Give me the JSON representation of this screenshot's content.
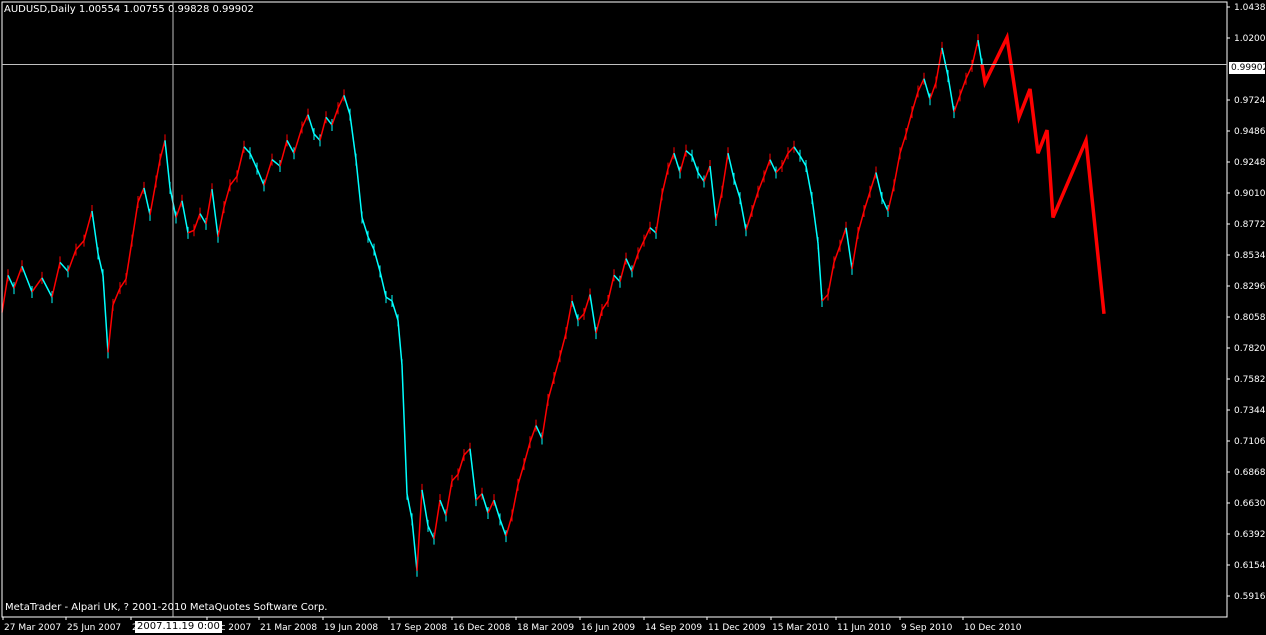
{
  "header": {
    "symbol_line": "AUDUSD,Daily  1.00554 1.00755 0.99828 0.99902"
  },
  "footer": {
    "copyright": "MetaTrader - Alpari UK, ? 2001-2010 MetaQuotes Software Corp."
  },
  "crosshair": {
    "date_label": "2007.11.19 0:00",
    "price_label": "0.99902"
  },
  "colors": {
    "background": "#000000",
    "bull": "#00ffff",
    "bear": "#ff0000",
    "projection": "#ff0000",
    "grid_text": "#ffffff"
  },
  "chart_data": {
    "type": "line",
    "symbol": "AUDUSD",
    "timeframe": "Daily",
    "ylim": [
      0.5916,
      1.0438
    ],
    "y_ticks": [
      "1.04380",
      "1.02000",
      "0.99902",
      "0.97240",
      "0.94860",
      "0.92480",
      "0.90100",
      "0.87720",
      "0.85340",
      "0.82960",
      "0.80580",
      "0.78200",
      "0.75820",
      "0.73440",
      "0.71060",
      "0.68680",
      "0.66300",
      "0.63920",
      "0.61540",
      "0.59160"
    ],
    "x_ticks": [
      "27 Mar 2007",
      "25 Jun 2007",
      "2",
      "Dec 2007",
      "21 Mar 2008",
      "19 Jun 2008",
      "17 Sep 2008",
      "16 Dec 2008",
      "18 Mar 2009",
      "16 Jun 2009",
      "14 Sep 2009",
      "11 Dec 2009",
      "15 Mar 2010",
      "11 Jun 2010",
      "9 Sep 2010",
      "10 Dec 2010"
    ],
    "crosshair_price": 0.99902,
    "price_path": [
      [
        0,
        0.806
      ],
      [
        6,
        0.835
      ],
      [
        12,
        0.825
      ],
      [
        20,
        0.842
      ],
      [
        30,
        0.822
      ],
      [
        40,
        0.833
      ],
      [
        50,
        0.818
      ],
      [
        58,
        0.845
      ],
      [
        66,
        0.838
      ],
      [
        74,
        0.855
      ],
      [
        82,
        0.862
      ],
      [
        90,
        0.885
      ],
      [
        96,
        0.852
      ],
      [
        101,
        0.835
      ],
      [
        106,
        0.775
      ],
      [
        111,
        0.812
      ],
      [
        118,
        0.825
      ],
      [
        124,
        0.832
      ],
      [
        130,
        0.862
      ],
      [
        136,
        0.892
      ],
      [
        142,
        0.903
      ],
      [
        148,
        0.882
      ],
      [
        154,
        0.908
      ],
      [
        158,
        0.925
      ],
      [
        163,
        0.94
      ],
      [
        168,
        0.903
      ],
      [
        174,
        0.88
      ],
      [
        180,
        0.893
      ],
      [
        186,
        0.868
      ],
      [
        192,
        0.87
      ],
      [
        198,
        0.883
      ],
      [
        204,
        0.875
      ],
      [
        210,
        0.902
      ],
      [
        216,
        0.865
      ],
      [
        222,
        0.888
      ],
      [
        228,
        0.905
      ],
      [
        235,
        0.912
      ],
      [
        242,
        0.935
      ],
      [
        248,
        0.93
      ],
      [
        255,
        0.918
      ],
      [
        262,
        0.905
      ],
      [
        270,
        0.925
      ],
      [
        278,
        0.92
      ],
      [
        285,
        0.94
      ],
      [
        292,
        0.93
      ],
      [
        300,
        0.95
      ],
      [
        306,
        0.96
      ],
      [
        312,
        0.945
      ],
      [
        318,
        0.94
      ],
      [
        324,
        0.958
      ],
      [
        330,
        0.952
      ],
      [
        336,
        0.965
      ],
      [
        342,
        0.975
      ],
      [
        348,
        0.96
      ],
      [
        354,
        0.925
      ],
      [
        360,
        0.88
      ],
      [
        366,
        0.865
      ],
      [
        372,
        0.855
      ],
      [
        378,
        0.838
      ],
      [
        384,
        0.818
      ],
      [
        390,
        0.815
      ],
      [
        396,
        0.8
      ],
      [
        400,
        0.765
      ],
      [
        405,
        0.665
      ],
      [
        410,
        0.645
      ],
      [
        415,
        0.605
      ],
      [
        420,
        0.668
      ],
      [
        426,
        0.64
      ],
      [
        432,
        0.63
      ],
      [
        438,
        0.66
      ],
      [
        444,
        0.648
      ],
      [
        450,
        0.675
      ],
      [
        456,
        0.68
      ],
      [
        462,
        0.695
      ],
      [
        468,
        0.7
      ],
      [
        474,
        0.66
      ],
      [
        480,
        0.665
      ],
      [
        486,
        0.65
      ],
      [
        492,
        0.66
      ],
      [
        498,
        0.645
      ],
      [
        504,
        0.632
      ],
      [
        510,
        0.648
      ],
      [
        516,
        0.672
      ],
      [
        522,
        0.688
      ],
      [
        528,
        0.705
      ],
      [
        534,
        0.718
      ],
      [
        540,
        0.708
      ],
      [
        546,
        0.738
      ],
      [
        552,
        0.755
      ],
      [
        558,
        0.772
      ],
      [
        564,
        0.79
      ],
      [
        570,
        0.815
      ],
      [
        576,
        0.8
      ],
      [
        582,
        0.805
      ],
      [
        588,
        0.82
      ],
      [
        594,
        0.79
      ],
      [
        600,
        0.808
      ],
      [
        606,
        0.815
      ],
      [
        612,
        0.835
      ],
      [
        618,
        0.83
      ],
      [
        624,
        0.848
      ],
      [
        630,
        0.838
      ],
      [
        636,
        0.852
      ],
      [
        642,
        0.862
      ],
      [
        648,
        0.872
      ],
      [
        654,
        0.868
      ],
      [
        660,
        0.898
      ],
      [
        666,
        0.918
      ],
      [
        672,
        0.93
      ],
      [
        678,
        0.915
      ],
      [
        684,
        0.932
      ],
      [
        690,
        0.928
      ],
      [
        696,
        0.915
      ],
      [
        702,
        0.908
      ],
      [
        708,
        0.92
      ],
      [
        714,
        0.878
      ],
      [
        720,
        0.9
      ],
      [
        726,
        0.93
      ],
      [
        732,
        0.91
      ],
      [
        738,
        0.895
      ],
      [
        744,
        0.87
      ],
      [
        750,
        0.885
      ],
      [
        756,
        0.9
      ],
      [
        762,
        0.912
      ],
      [
        768,
        0.925
      ],
      [
        774,
        0.915
      ],
      [
        780,
        0.92
      ],
      [
        786,
        0.93
      ],
      [
        792,
        0.935
      ],
      [
        798,
        0.928
      ],
      [
        804,
        0.92
      ],
      [
        810,
        0.895
      ],
      [
        816,
        0.86
      ],
      [
        820,
        0.815
      ],
      [
        826,
        0.82
      ],
      [
        832,
        0.845
      ],
      [
        838,
        0.858
      ],
      [
        844,
        0.872
      ],
      [
        850,
        0.84
      ],
      [
        856,
        0.868
      ],
      [
        862,
        0.885
      ],
      [
        868,
        0.9
      ],
      [
        874,
        0.915
      ],
      [
        880,
        0.895
      ],
      [
        886,
        0.885
      ],
      [
        892,
        0.905
      ],
      [
        898,
        0.93
      ],
      [
        904,
        0.945
      ],
      [
        910,
        0.962
      ],
      [
        916,
        0.978
      ],
      [
        922,
        0.988
      ],
      [
        928,
        0.972
      ],
      [
        934,
        0.985
      ],
      [
        940,
        1.012
      ],
      [
        946,
        0.99
      ],
      [
        952,
        0.962
      ],
      [
        958,
        0.975
      ],
      [
        964,
        0.988
      ],
      [
        970,
        0.998
      ],
      [
        976,
        1.018
      ],
      [
        980,
        0.999
      ]
    ],
    "projection_path": [
      [
        980,
        0.999
      ],
      [
        983,
        0.985
      ],
      [
        1005,
        1.02
      ],
      [
        1017,
        0.958
      ],
      [
        1028,
        0.98
      ],
      [
        1036,
        0.93
      ],
      [
        1045,
        0.948
      ],
      [
        1051,
        0.88
      ],
      [
        1084,
        0.94
      ],
      [
        1102,
        0.805
      ]
    ]
  }
}
